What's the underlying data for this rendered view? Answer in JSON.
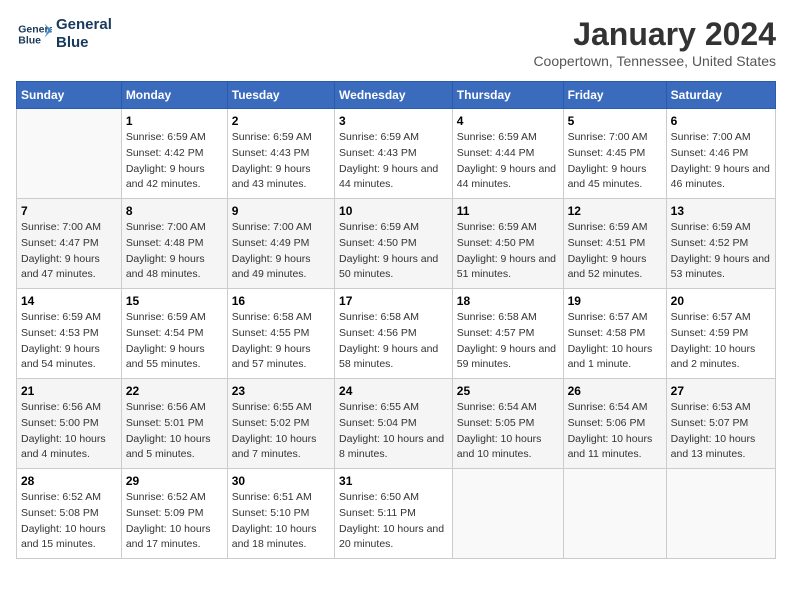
{
  "header": {
    "logo_line1": "General",
    "logo_line2": "Blue",
    "title": "January 2024",
    "subtitle": "Coopertown, Tennessee, United States"
  },
  "calendar": {
    "days_of_week": [
      "Sunday",
      "Monday",
      "Tuesday",
      "Wednesday",
      "Thursday",
      "Friday",
      "Saturday"
    ],
    "weeks": [
      [
        {
          "day": "",
          "sunrise": "",
          "sunset": "",
          "daylight": ""
        },
        {
          "day": "1",
          "sunrise": "Sunrise: 6:59 AM",
          "sunset": "Sunset: 4:42 PM",
          "daylight": "Daylight: 9 hours and 42 minutes."
        },
        {
          "day": "2",
          "sunrise": "Sunrise: 6:59 AM",
          "sunset": "Sunset: 4:43 PM",
          "daylight": "Daylight: 9 hours and 43 minutes."
        },
        {
          "day": "3",
          "sunrise": "Sunrise: 6:59 AM",
          "sunset": "Sunset: 4:43 PM",
          "daylight": "Daylight: 9 hours and 44 minutes."
        },
        {
          "day": "4",
          "sunrise": "Sunrise: 6:59 AM",
          "sunset": "Sunset: 4:44 PM",
          "daylight": "Daylight: 9 hours and 44 minutes."
        },
        {
          "day": "5",
          "sunrise": "Sunrise: 7:00 AM",
          "sunset": "Sunset: 4:45 PM",
          "daylight": "Daylight: 9 hours and 45 minutes."
        },
        {
          "day": "6",
          "sunrise": "Sunrise: 7:00 AM",
          "sunset": "Sunset: 4:46 PM",
          "daylight": "Daylight: 9 hours and 46 minutes."
        }
      ],
      [
        {
          "day": "7",
          "sunrise": "Sunrise: 7:00 AM",
          "sunset": "Sunset: 4:47 PM",
          "daylight": "Daylight: 9 hours and 47 minutes."
        },
        {
          "day": "8",
          "sunrise": "Sunrise: 7:00 AM",
          "sunset": "Sunset: 4:48 PM",
          "daylight": "Daylight: 9 hours and 48 minutes."
        },
        {
          "day": "9",
          "sunrise": "Sunrise: 7:00 AM",
          "sunset": "Sunset: 4:49 PM",
          "daylight": "Daylight: 9 hours and 49 minutes."
        },
        {
          "day": "10",
          "sunrise": "Sunrise: 6:59 AM",
          "sunset": "Sunset: 4:50 PM",
          "daylight": "Daylight: 9 hours and 50 minutes."
        },
        {
          "day": "11",
          "sunrise": "Sunrise: 6:59 AM",
          "sunset": "Sunset: 4:50 PM",
          "daylight": "Daylight: 9 hours and 51 minutes."
        },
        {
          "day": "12",
          "sunrise": "Sunrise: 6:59 AM",
          "sunset": "Sunset: 4:51 PM",
          "daylight": "Daylight: 9 hours and 52 minutes."
        },
        {
          "day": "13",
          "sunrise": "Sunrise: 6:59 AM",
          "sunset": "Sunset: 4:52 PM",
          "daylight": "Daylight: 9 hours and 53 minutes."
        }
      ],
      [
        {
          "day": "14",
          "sunrise": "Sunrise: 6:59 AM",
          "sunset": "Sunset: 4:53 PM",
          "daylight": "Daylight: 9 hours and 54 minutes."
        },
        {
          "day": "15",
          "sunrise": "Sunrise: 6:59 AM",
          "sunset": "Sunset: 4:54 PM",
          "daylight": "Daylight: 9 hours and 55 minutes."
        },
        {
          "day": "16",
          "sunrise": "Sunrise: 6:58 AM",
          "sunset": "Sunset: 4:55 PM",
          "daylight": "Daylight: 9 hours and 57 minutes."
        },
        {
          "day": "17",
          "sunrise": "Sunrise: 6:58 AM",
          "sunset": "Sunset: 4:56 PM",
          "daylight": "Daylight: 9 hours and 58 minutes."
        },
        {
          "day": "18",
          "sunrise": "Sunrise: 6:58 AM",
          "sunset": "Sunset: 4:57 PM",
          "daylight": "Daylight: 9 hours and 59 minutes."
        },
        {
          "day": "19",
          "sunrise": "Sunrise: 6:57 AM",
          "sunset": "Sunset: 4:58 PM",
          "daylight": "Daylight: 10 hours and 1 minute."
        },
        {
          "day": "20",
          "sunrise": "Sunrise: 6:57 AM",
          "sunset": "Sunset: 4:59 PM",
          "daylight": "Daylight: 10 hours and 2 minutes."
        }
      ],
      [
        {
          "day": "21",
          "sunrise": "Sunrise: 6:56 AM",
          "sunset": "Sunset: 5:00 PM",
          "daylight": "Daylight: 10 hours and 4 minutes."
        },
        {
          "day": "22",
          "sunrise": "Sunrise: 6:56 AM",
          "sunset": "Sunset: 5:01 PM",
          "daylight": "Daylight: 10 hours and 5 minutes."
        },
        {
          "day": "23",
          "sunrise": "Sunrise: 6:55 AM",
          "sunset": "Sunset: 5:02 PM",
          "daylight": "Daylight: 10 hours and 7 minutes."
        },
        {
          "day": "24",
          "sunrise": "Sunrise: 6:55 AM",
          "sunset": "Sunset: 5:04 PM",
          "daylight": "Daylight: 10 hours and 8 minutes."
        },
        {
          "day": "25",
          "sunrise": "Sunrise: 6:54 AM",
          "sunset": "Sunset: 5:05 PM",
          "daylight": "Daylight: 10 hours and 10 minutes."
        },
        {
          "day": "26",
          "sunrise": "Sunrise: 6:54 AM",
          "sunset": "Sunset: 5:06 PM",
          "daylight": "Daylight: 10 hours and 11 minutes."
        },
        {
          "day": "27",
          "sunrise": "Sunrise: 6:53 AM",
          "sunset": "Sunset: 5:07 PM",
          "daylight": "Daylight: 10 hours and 13 minutes."
        }
      ],
      [
        {
          "day": "28",
          "sunrise": "Sunrise: 6:52 AM",
          "sunset": "Sunset: 5:08 PM",
          "daylight": "Daylight: 10 hours and 15 minutes."
        },
        {
          "day": "29",
          "sunrise": "Sunrise: 6:52 AM",
          "sunset": "Sunset: 5:09 PM",
          "daylight": "Daylight: 10 hours and 17 minutes."
        },
        {
          "day": "30",
          "sunrise": "Sunrise: 6:51 AM",
          "sunset": "Sunset: 5:10 PM",
          "daylight": "Daylight: 10 hours and 18 minutes."
        },
        {
          "day": "31",
          "sunrise": "Sunrise: 6:50 AM",
          "sunset": "Sunset: 5:11 PM",
          "daylight": "Daylight: 10 hours and 20 minutes."
        },
        {
          "day": "",
          "sunrise": "",
          "sunset": "",
          "daylight": ""
        },
        {
          "day": "",
          "sunrise": "",
          "sunset": "",
          "daylight": ""
        },
        {
          "day": "",
          "sunrise": "",
          "sunset": "",
          "daylight": ""
        }
      ]
    ]
  }
}
